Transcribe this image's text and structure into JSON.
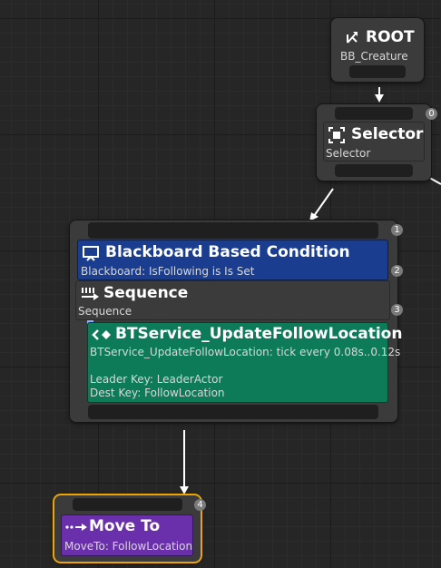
{
  "nodes": {
    "root": {
      "title": "ROOT",
      "subtitle": "BB_Creature"
    },
    "selector": {
      "title": "Selector",
      "subtitle": "Selector",
      "order": "0"
    },
    "composite": {
      "order": "1",
      "decorator": {
        "title": "Blackboard Based Condition",
        "subtitle": "Blackboard: IsFollowing is Is Set",
        "order": "2"
      },
      "sequence": {
        "title": "Sequence",
        "subtitle": "Sequence",
        "order": "3"
      },
      "service": {
        "title": "BTService_UpdateFollowLocation",
        "line1": "BTService_UpdateFollowLocation: tick every 0.08s..0.12s",
        "line2": "Leader Key: LeaderActor",
        "line3": "Dest Key: FollowLocation"
      }
    },
    "moveto": {
      "title": "Move To",
      "subtitle": "MoveTo: FollowLocation",
      "order": "4"
    }
  },
  "icons": [
    "branch-icon",
    "selector-icon",
    "blackboard-icon",
    "sequence-icon",
    "service-icon",
    "moveto-icon"
  ],
  "colors": {
    "decorator": "#1a3d8f",
    "service": "#0d7a58",
    "task": "#6a2faa",
    "selected_outline": "#f0a400"
  }
}
